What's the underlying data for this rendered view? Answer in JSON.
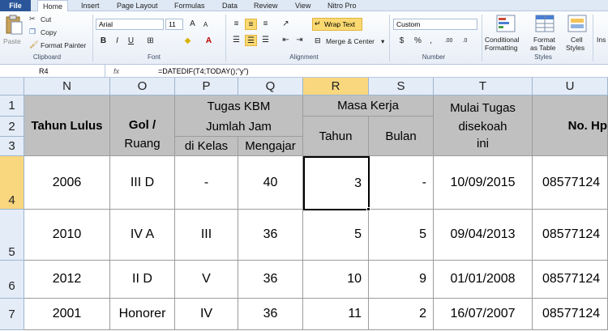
{
  "ribbon": {
    "tabs": [
      "File",
      "Home",
      "Insert",
      "Page Layout",
      "Formulas",
      "Data",
      "Review",
      "View",
      "Nitro Pro"
    ],
    "clipboard": {
      "paste": "Paste",
      "cut": "Cut",
      "copy": "Copy",
      "format_painter": "Format Painter",
      "label": "Clipboard"
    },
    "font": {
      "name": "Arial",
      "size": "11",
      "bold": "B",
      "italic": "I",
      "underline": "U",
      "label": "Font"
    },
    "alignment": {
      "wrap_text": "Wrap Text",
      "merge_center": "Merge & Center",
      "label": "Alignment"
    },
    "number": {
      "format": "Custom",
      "label": "Number"
    },
    "styles": {
      "conditional": "Conditional",
      "formatting": "Formatting",
      "format_as": "Format",
      "as_table": "as Table",
      "cell": "Cell",
      "cell_styles": "Styles",
      "label": "Styles"
    },
    "insert": "Ins"
  },
  "formula_bar": {
    "name_box": "R4",
    "fx": "fx",
    "formula": "=DATEDIF(T4;TODAY();\"y\")"
  },
  "columns": [
    "N",
    "O",
    "P",
    "Q",
    "R",
    "S",
    "T",
    "U"
  ],
  "rows": [
    "1",
    "2",
    "3",
    "4",
    "5",
    "6",
    "7"
  ],
  "headers": {
    "tahun_lulus": "Tahun Lulus",
    "gol": "Gol /",
    "ruang": "Ruang",
    "tugas_kbm": "Tugas KBM",
    "jumlah_jam": "Jumlah Jam",
    "di_kelas": "di Kelas",
    "mengajar": "Mengajar",
    "masa_kerja": "Masa Kerja",
    "tahun": "Tahun",
    "bulan": "Bulan",
    "mulai_tugas": "Mulai Tugas",
    "disekoah": "disekoah",
    "ini": "ini",
    "no_hp": "No. Hp"
  },
  "data_rows": [
    [
      "2006",
      "III D",
      "-",
      "40",
      "3",
      "-",
      "10/09/2015",
      "08577124"
    ],
    [
      "2010",
      "IV A",
      "III",
      "36",
      "5",
      "5",
      "09/04/2013",
      "08577124"
    ],
    [
      "2012",
      "II D",
      "V",
      "36",
      "10",
      "9",
      "01/01/2008",
      "08577124"
    ],
    [
      "2001",
      "Honorer",
      "IV",
      "36",
      "11",
      "2",
      "16/07/2007",
      "08577124"
    ]
  ]
}
